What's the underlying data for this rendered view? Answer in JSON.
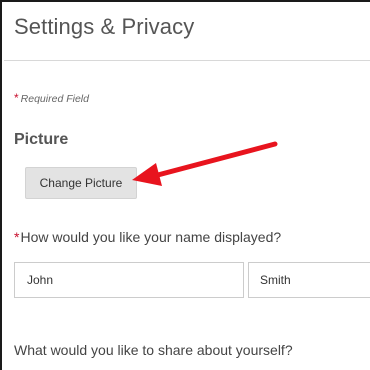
{
  "page": {
    "title": "Settings & Privacy"
  },
  "required_note": {
    "asterisk": "*",
    "text": "Required Field"
  },
  "picture_section": {
    "heading": "Picture",
    "change_button_label": "Change Picture"
  },
  "name_section": {
    "asterisk": "*",
    "question": "How would you like your name displayed?",
    "first_name_value": "John",
    "last_name_value": "Smith"
  },
  "about_section": {
    "question": "What would you like to share about yourself?"
  },
  "annotation": {
    "arrow_color": "#e8141e",
    "arrow_icon": "arrow-pointer-icon"
  },
  "colors": {
    "required_asterisk": "#c8102e",
    "button_bg": "#e3e3e3",
    "title_text": "#555555"
  }
}
